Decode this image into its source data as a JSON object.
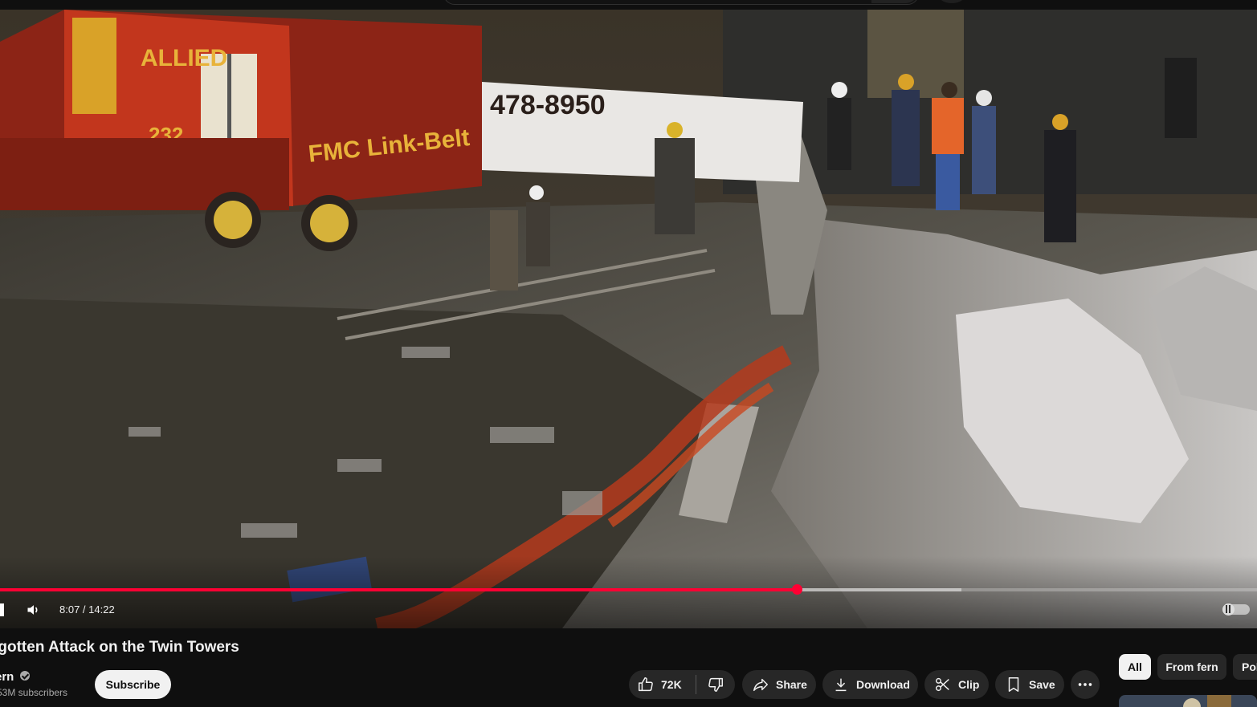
{
  "player": {
    "current_time": "8:07",
    "duration": "14:22",
    "time_display": "8:07 / 14:22",
    "progress_played": 0.634,
    "progress_loaded": 0.765,
    "scene_text": {
      "crane_brand": "FMC Link-Belt",
      "crane_name": "ALLIED",
      "crane_number": "232",
      "truck_phone": "478-8950"
    }
  },
  "video": {
    "title": "rgotten Attack on the Twin Towers",
    "channel": "ern",
    "subscribers": "53M subscribers",
    "subscribe_label": "Subscribe"
  },
  "actions": {
    "like_count": "72K",
    "share_label": "Share",
    "download_label": "Download",
    "clip_label": "Clip",
    "save_label": "Save"
  },
  "chips": {
    "all": "All",
    "from_channel": "From fern",
    "partial": "Pol"
  },
  "colors": {
    "accent": "#ff0033",
    "background": "#0f0f0f",
    "pill": "#272727"
  }
}
